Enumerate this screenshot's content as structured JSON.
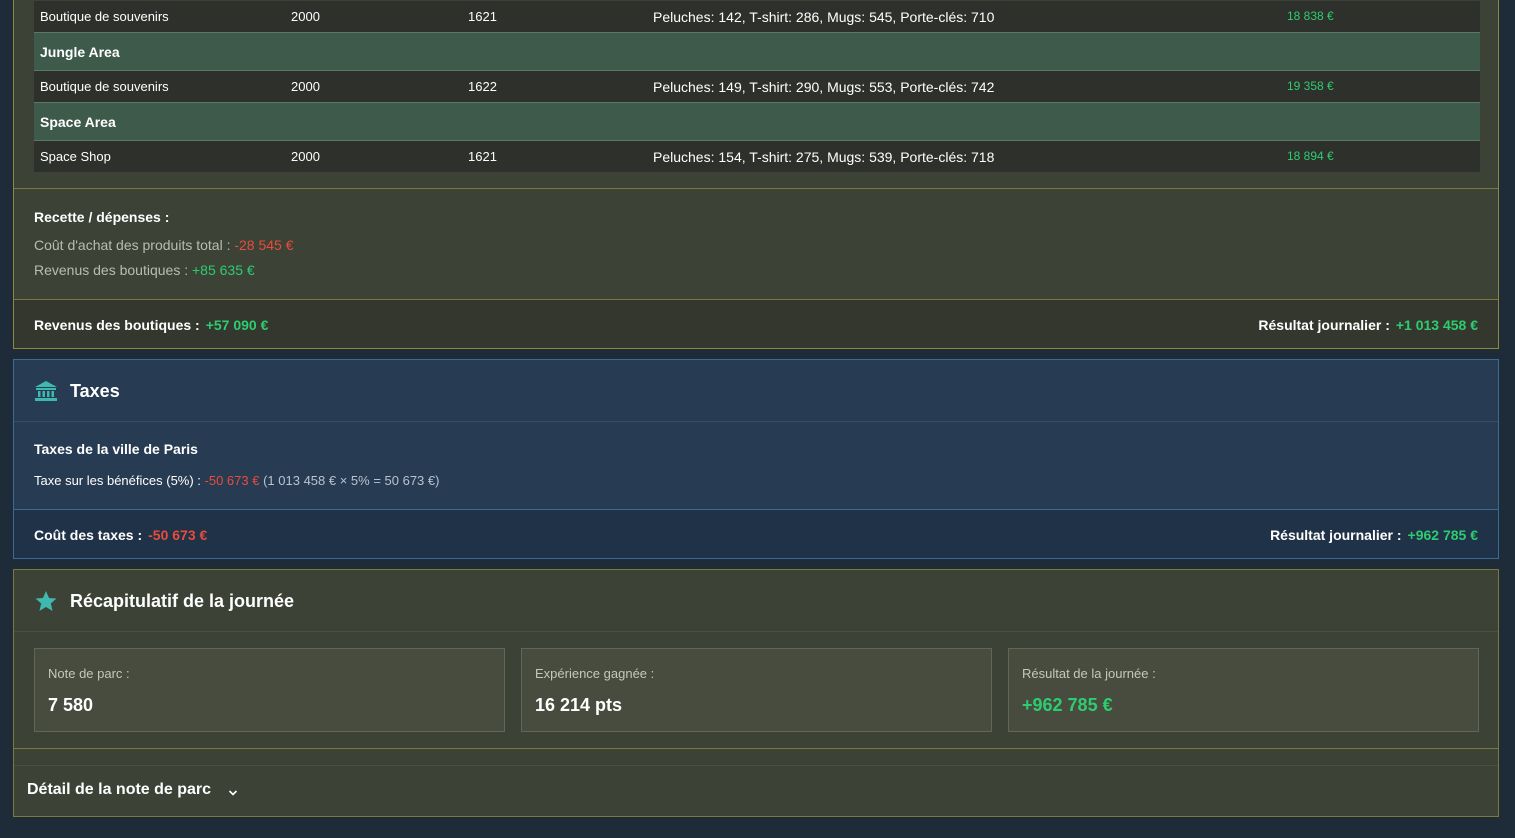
{
  "shops": {
    "rows": [
      {
        "type": "shop",
        "name": "Boutique de souvenirs",
        "col_a": "2000",
        "col_b": "1621",
        "stock": "Peluches: 142, T-shirt: 286, Mugs: 545, Porte-clés: 710",
        "revenue": "18 838 €"
      },
      {
        "type": "area",
        "name": "Jungle Area"
      },
      {
        "type": "shop",
        "name": "Boutique de souvenirs",
        "col_a": "2000",
        "col_b": "1622",
        "stock": "Peluches: 149, T-shirt: 290, Mugs: 553, Porte-clés: 742",
        "revenue": "19 358 €"
      },
      {
        "type": "area",
        "name": "Space Area"
      },
      {
        "type": "shop",
        "name": "Space Shop",
        "col_a": "2000",
        "col_b": "1621",
        "stock": "Peluches: 154, T-shirt: 275, Mugs: 539, Porte-clés: 718",
        "revenue": "18 894 €"
      }
    ],
    "summary": {
      "title": "Recette / dépenses :",
      "cost_label": "Coût d'achat des produits total :",
      "cost_value": "-28 545 €",
      "revenue_label": "Revenus des boutiques :",
      "revenue_value": "+85 635 €"
    },
    "footer": {
      "left_label": "Revenus des boutiques :",
      "left_value": "+57 090 €",
      "right_label": "Résultat journalier :",
      "right_value": "+1 013 458 €"
    }
  },
  "taxes": {
    "title": "Taxes",
    "icon": "bank-icon",
    "city_title": "Taxes de la ville de Paris",
    "line_label": "Taxe sur les bénéfices (5%) :",
    "line_value": "-50 673 €",
    "line_calc": "(1 013 458 € × 5% = 50 673 €)",
    "footer": {
      "left_label": "Coût des taxes :",
      "left_value": "-50 673 €",
      "right_label": "Résultat journalier :",
      "right_value": "+962 785 €"
    }
  },
  "recap": {
    "title": "Récapitulatif de la journée",
    "icon": "star-icon",
    "cards": [
      {
        "label": "Note de parc :",
        "value": "7 580"
      },
      {
        "label": "Expérience gagnée :",
        "value": "16 214 pts"
      },
      {
        "label": "Résultat de la journée :",
        "value": "+962 785 €"
      }
    ],
    "detail_toggle": "Détail de la note de parc"
  },
  "colors": {
    "positive": "#2ecc71",
    "negative": "#e74c3c",
    "accent_teal": "#3fb8af"
  }
}
